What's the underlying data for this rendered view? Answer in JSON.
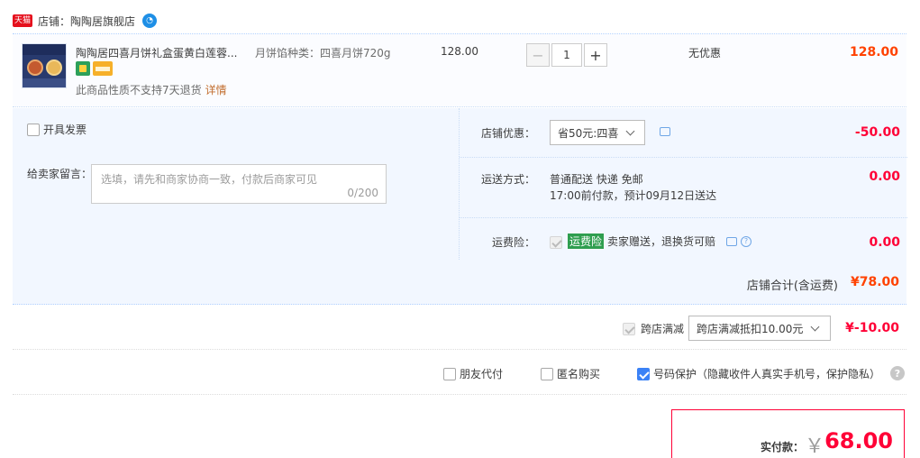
{
  "shop": {
    "tag": "天猫",
    "label": "店铺：陶陶居旗舰店"
  },
  "item": {
    "title": "陶陶居四喜月饼礼盒蛋黄白莲蓉...",
    "sku": "月饼馅种类：四喜月饼720g",
    "notice": "此商品性质不支持7天退货",
    "notice_link": "详情",
    "price": "128.00",
    "quantity": "1",
    "minus": "−",
    "plus": "+",
    "promotion": "无优惠",
    "subtotal": "128.00"
  },
  "options": {
    "invoice_label": "开具发票",
    "memo_label": "给卖家留言：",
    "memo_placeholder": "选填，请先和商家协商一致，付款后商家可见",
    "memo_count": "0/200",
    "shop_discount_label": "店铺优惠：",
    "shop_discount_value": "省50元:四喜",
    "shop_discount_amount": "-50.00",
    "delivery_label": "运送方式：",
    "delivery_line1": "普通配送 快递 免邮",
    "delivery_line2": "17:00前付款，预计09月12日送达",
    "delivery_amount": "0.00",
    "insurance_label": "运费险：",
    "insurance_badge": "运费险",
    "insurance_text": "卖家赠送，退换货可赔",
    "insurance_amount": "0.00"
  },
  "shop_total": {
    "label": "店铺合计(含运费)",
    "amount": "¥78.00"
  },
  "cross_store": {
    "label": "跨店满减",
    "select": "跨店满减抵扣10.00元",
    "amount": "¥-10.00"
  },
  "extras": {
    "friend_pay": "朋友代付",
    "anonymous": "匿名购买",
    "number_protect": "号码保护（隐藏收件人真实手机号，保护隐私）"
  },
  "payment": {
    "label": "实付款：",
    "yen": "￥",
    "amount": "68.00"
  },
  "colors": {
    "accent_red": "#ff0036",
    "orange": "#ff4200",
    "panel_blue": "#f2f7ff",
    "check_blue": "#3b82f6"
  }
}
